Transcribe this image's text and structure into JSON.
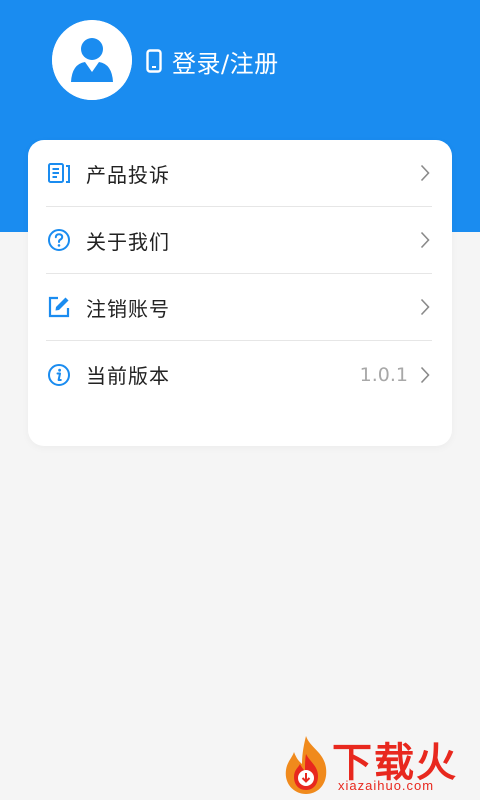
{
  "header": {
    "login_label": "登录/注册",
    "background": "#1a8cf0"
  },
  "menu": {
    "items": [
      {
        "label": "产品投诉",
        "icon": "complaint-icon",
        "value": ""
      },
      {
        "label": "关于我们",
        "icon": "question-icon",
        "value": ""
      },
      {
        "label": "注销账号",
        "icon": "edit-icon",
        "value": ""
      },
      {
        "label": "当前版本",
        "icon": "info-icon",
        "value": "1.0.1"
      }
    ]
  },
  "watermark": {
    "title": "下载火",
    "site": "xiazaihuo.com"
  },
  "colors": {
    "accent": "#1a8cf0",
    "icon": "#1a8cf0",
    "brand_red": "#e8281e"
  }
}
